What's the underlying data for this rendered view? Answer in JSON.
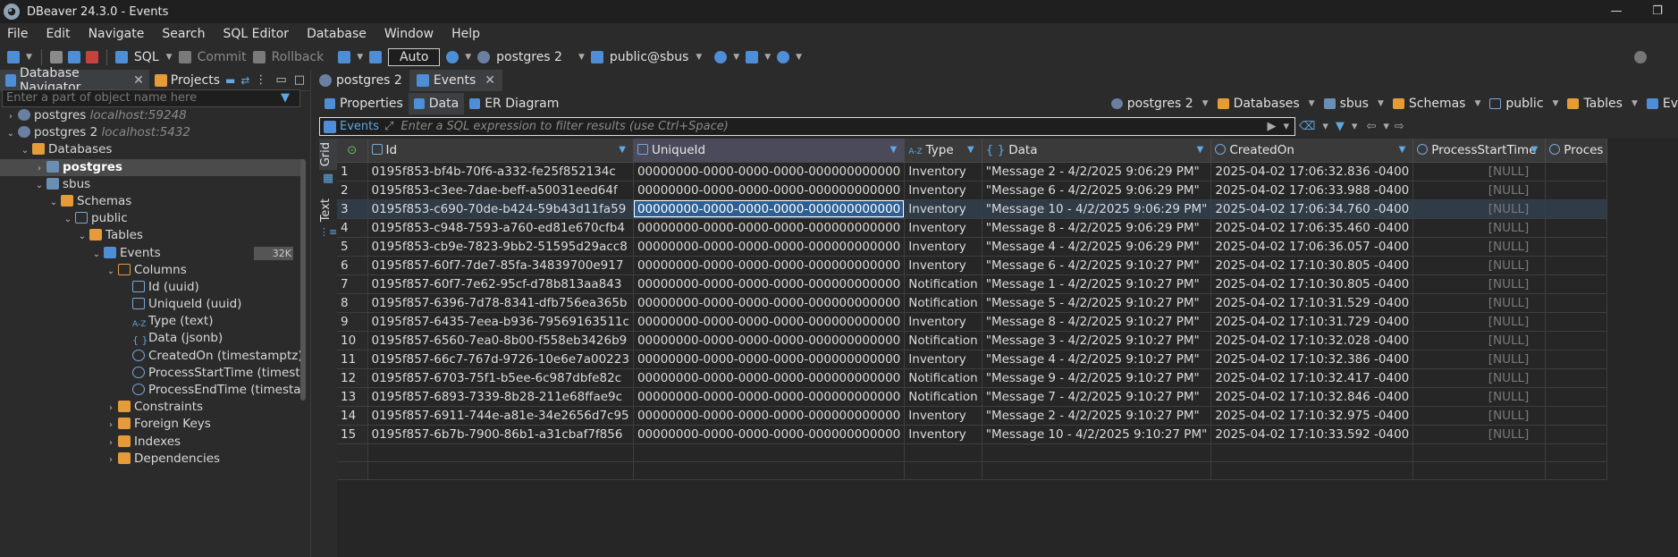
{
  "window": {
    "title": "DBeaver 24.3.0 - Events",
    "minimize": "—",
    "restore": "❐"
  },
  "menu": [
    "File",
    "Edit",
    "Navigate",
    "Search",
    "SQL Editor",
    "Database",
    "Window",
    "Help"
  ],
  "toolbar": {
    "sql": "SQL",
    "commit": "Commit",
    "rollback": "Rollback",
    "transaction_mode": "Auto",
    "connection": "postgres 2",
    "schema": "public@sbus"
  },
  "navigator": {
    "tabs": [
      "Database Navigator",
      "Projects"
    ],
    "filter_placeholder": "Enter a part of object name here",
    "tree": [
      {
        "label": "postgres",
        "extra": "localhost:59248"
      },
      {
        "label": "postgres 2",
        "extra": "localhost:5432"
      },
      {
        "label": "Databases"
      },
      {
        "label": "postgres"
      },
      {
        "label": "sbus"
      },
      {
        "label": "Schemas"
      },
      {
        "label": "public"
      },
      {
        "label": "Tables"
      },
      {
        "label": "Events",
        "badge": "32K"
      },
      {
        "label": "Columns"
      },
      {
        "label": "Id (uuid)"
      },
      {
        "label": "UniqueId (uuid)"
      },
      {
        "label": "Type (text)"
      },
      {
        "label": "Data (jsonb)"
      },
      {
        "label": "CreatedOn (timestamptz)"
      },
      {
        "label": "ProcessStartTime (timestamptz)"
      },
      {
        "label": "ProcessEndTime (timestamptz)"
      },
      {
        "label": "Constraints"
      },
      {
        "label": "Foreign Keys"
      },
      {
        "label": "Indexes"
      },
      {
        "label": "Dependencies"
      }
    ]
  },
  "editor": {
    "tabs": [
      "postgres 2",
      "Events"
    ],
    "subtabs": [
      "Properties",
      "Data",
      "ER Diagram"
    ],
    "breadcrumbs": [
      "postgres 2",
      "Databases",
      "sbus",
      "Schemas",
      "public",
      "Tables",
      "Ev"
    ],
    "filter_label": "Events",
    "filter_placeholder": "Enter a SQL expression to filter results (use Ctrl+Space)",
    "view_tabs": [
      "Grid",
      "Text"
    ]
  },
  "grid": {
    "columns": [
      "Id",
      "UniqueId",
      "Type",
      "Data",
      "CreatedOn",
      "ProcessStartTime",
      "Proces"
    ],
    "rows": [
      [
        "1",
        "0195f853-bf4b-70f6-a332-fe25f852134c",
        "00000000-0000-0000-0000-000000000000",
        "Inventory",
        "\"Message 2 - 4/2/2025 9:06:29 PM\"",
        "2025-04-02 17:06:32.836 -0400",
        "[NULL]"
      ],
      [
        "2",
        "0195f853-c3ee-7dae-beff-a50031eed64f",
        "00000000-0000-0000-0000-000000000000",
        "Inventory",
        "\"Message 6 - 4/2/2025 9:06:29 PM\"",
        "2025-04-02 17:06:33.988 -0400",
        "[NULL]"
      ],
      [
        "3",
        "0195f853-c690-70de-b424-59b43d11fa59",
        "00000000-0000-0000-0000-000000000000",
        "Inventory",
        "\"Message 10 - 4/2/2025 9:06:29 PM\"",
        "2025-04-02 17:06:34.760 -0400",
        "[NULL]"
      ],
      [
        "4",
        "0195f853-c948-7593-a760-ed81e670cfb4",
        "00000000-0000-0000-0000-000000000000",
        "Inventory",
        "\"Message 8 - 4/2/2025 9:06:29 PM\"",
        "2025-04-02 17:06:35.460 -0400",
        "[NULL]"
      ],
      [
        "5",
        "0195f853-cb9e-7823-9bb2-51595d29acc8",
        "00000000-0000-0000-0000-000000000000",
        "Inventory",
        "\"Message 4 - 4/2/2025 9:06:29 PM\"",
        "2025-04-02 17:06:36.057 -0400",
        "[NULL]"
      ],
      [
        "6",
        "0195f857-60f7-7de7-85fa-34839700e917",
        "00000000-0000-0000-0000-000000000000",
        "Inventory",
        "\"Message 6 - 4/2/2025 9:10:27 PM\"",
        "2025-04-02 17:10:30.805 -0400",
        "[NULL]"
      ],
      [
        "7",
        "0195f857-60f7-7e62-95cf-d78b813aa843",
        "00000000-0000-0000-0000-000000000000",
        "Notification",
        "\"Message 1 - 4/2/2025 9:10:27 PM\"",
        "2025-04-02 17:10:30.805 -0400",
        "[NULL]"
      ],
      [
        "8",
        "0195f857-6396-7d78-8341-dfb756ea365b",
        "00000000-0000-0000-0000-000000000000",
        "Notification",
        "\"Message 5 - 4/2/2025 9:10:27 PM\"",
        "2025-04-02 17:10:31.529 -0400",
        "[NULL]"
      ],
      [
        "9",
        "0195f857-6435-7eea-b936-79569163511c",
        "00000000-0000-0000-0000-000000000000",
        "Inventory",
        "\"Message 8 - 4/2/2025 9:10:27 PM\"",
        "2025-04-02 17:10:31.729 -0400",
        "[NULL]"
      ],
      [
        "10",
        "0195f857-6560-7ea0-8b00-f558eb3426b9",
        "00000000-0000-0000-0000-000000000000",
        "Notification",
        "\"Message 3 - 4/2/2025 9:10:27 PM\"",
        "2025-04-02 17:10:32.028 -0400",
        "[NULL]"
      ],
      [
        "11",
        "0195f857-66c7-767d-9726-10e6e7a00223",
        "00000000-0000-0000-0000-000000000000",
        "Inventory",
        "\"Message 4 - 4/2/2025 9:10:27 PM\"",
        "2025-04-02 17:10:32.386 -0400",
        "[NULL]"
      ],
      [
        "12",
        "0195f857-6703-75f1-b5ee-6c987dbfe82c",
        "00000000-0000-0000-0000-000000000000",
        "Notification",
        "\"Message 9 - 4/2/2025 9:10:27 PM\"",
        "2025-04-02 17:10:32.417 -0400",
        "[NULL]"
      ],
      [
        "13",
        "0195f857-6893-7339-8b28-211e68ffae9c",
        "00000000-0000-0000-0000-000000000000",
        "Notification",
        "\"Message 7 - 4/2/2025 9:10:27 PM\"",
        "2025-04-02 17:10:32.846 -0400",
        "[NULL]"
      ],
      [
        "14",
        "0195f857-6911-744e-a81e-34e2656d7c95",
        "00000000-0000-0000-0000-000000000000",
        "Inventory",
        "\"Message 2 - 4/2/2025 9:10:27 PM\"",
        "2025-04-02 17:10:32.975 -0400",
        "[NULL]"
      ],
      [
        "15",
        "0195f857-6b7b-7900-86b1-a31cbaf7f856",
        "00000000-0000-0000-0000-000000000000",
        "Inventory",
        "\"Message 10 - 4/2/2025 9:10:27 PM\"",
        "2025-04-02 17:10:33.592 -0400",
        "[NULL]"
      ]
    ]
  }
}
